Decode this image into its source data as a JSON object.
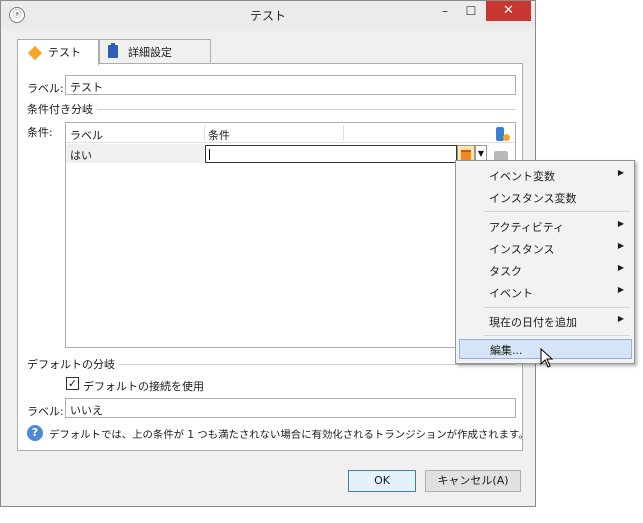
{
  "window": {
    "title": "テスト",
    "minimize": "–",
    "maximize": "☐",
    "close": "✕"
  },
  "tabs": [
    {
      "label": "テスト"
    },
    {
      "label": "詳細設定"
    }
  ],
  "form": {
    "label_caption": "ラベル:",
    "label_value": "テスト",
    "conditional_section": "条件付き分岐",
    "conditions_caption": "条件:",
    "grid_headers": {
      "label": "ラベル",
      "condition": "条件"
    },
    "grid_rows": [
      {
        "label": "はい",
        "condition": ""
      }
    ],
    "default_section": "デフォルトの分岐",
    "use_default_checkbox": "デフォルトの接続を使用",
    "use_default_checked": true,
    "default_label_caption": "ラベル:",
    "default_label_value": "いいえ",
    "info_text": "デフォルトでは、上の条件が 1 つも満たされない場合に有効化されるトランジションが作成されます。"
  },
  "buttons": {
    "ok": "OK",
    "cancel": "キャンセル(A)"
  },
  "context_menu": [
    {
      "label": "イベント変数",
      "submenu": true
    },
    {
      "label": "インスタンス変数",
      "submenu": false
    },
    {
      "label": "アクティビティ",
      "submenu": true
    },
    {
      "label": "インスタンス",
      "submenu": true
    },
    {
      "label": "タスク",
      "submenu": true
    },
    {
      "label": "イベント",
      "submenu": true
    },
    {
      "label": "現在の日付を追加",
      "submenu": true
    },
    {
      "label": "編集...",
      "submenu": false,
      "hover": true
    }
  ],
  "colors": {
    "accent": "#f5a623",
    "close_button": "#c7372f",
    "menu_hover": "#d5e5f7"
  }
}
